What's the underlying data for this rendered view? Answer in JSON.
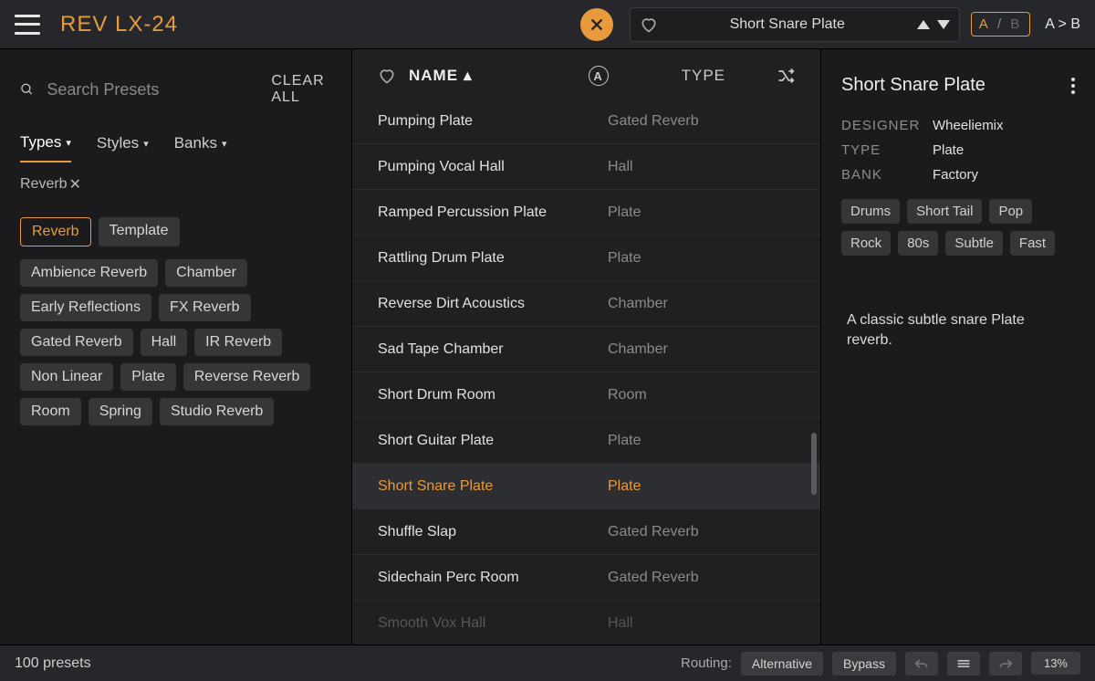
{
  "header": {
    "product_name": "REV LX-24",
    "current_preset": "Short Snare Plate",
    "ab": {
      "a": "A",
      "sep": "/",
      "b": "B",
      "copy": "A > B"
    }
  },
  "sidebar": {
    "search_placeholder": "Search Presets",
    "clear_all": "CLEAR ALL",
    "tabs": {
      "types": "Types",
      "styles": "Styles",
      "banks": "Banks"
    },
    "active_filter": "Reverb",
    "primary_tags": [
      "Reverb",
      "Template"
    ],
    "sub_tags": [
      "Ambience Reverb",
      "Chamber",
      "Early Reflections",
      "FX Reverb",
      "Gated Reverb",
      "Hall",
      "IR Reverb",
      "Non Linear",
      "Plate",
      "Reverse Reverb",
      "Room",
      "Spring",
      "Studio Reverb"
    ]
  },
  "list": {
    "cols": {
      "name": "NAME",
      "type": "TYPE"
    },
    "rows": [
      {
        "name": "Pumping Plate",
        "type": "Gated Reverb",
        "sel": false
      },
      {
        "name": "Pumping Vocal Hall",
        "type": "Hall",
        "sel": false
      },
      {
        "name": "Ramped Percussion Plate",
        "type": "Plate",
        "sel": false
      },
      {
        "name": "Rattling Drum Plate",
        "type": "Plate",
        "sel": false
      },
      {
        "name": "Reverse Dirt Acoustics",
        "type": "Chamber",
        "sel": false
      },
      {
        "name": "Sad Tape Chamber",
        "type": "Chamber",
        "sel": false
      },
      {
        "name": "Short Drum Room",
        "type": "Room",
        "sel": false
      },
      {
        "name": "Short Guitar Plate",
        "type": "Plate",
        "sel": false
      },
      {
        "name": "Short Snare Plate",
        "type": "Plate",
        "sel": true
      },
      {
        "name": "Shuffle Slap",
        "type": "Gated Reverb",
        "sel": false
      },
      {
        "name": "Sidechain Perc Room",
        "type": "Gated Reverb",
        "sel": false
      },
      {
        "name": "Smooth Vox Hall",
        "type": "Hall",
        "sel": false,
        "faded": true
      }
    ]
  },
  "detail": {
    "title": "Short Snare Plate",
    "meta": {
      "designer_k": "DESIGNER",
      "designer_v": "Wheeliemix",
      "type_k": "TYPE",
      "type_v": "Plate",
      "bank_k": "BANK",
      "bank_v": "Factory"
    },
    "tags": [
      "Drums",
      "Short Tail",
      "Pop",
      "Rock",
      "80s",
      "Subtle",
      "Fast"
    ],
    "description": "A classic subtle snare Plate reverb."
  },
  "footer": {
    "count": "100 presets",
    "routing_label": "Routing:",
    "routing_value": "Alternative",
    "bypass": "Bypass",
    "cpu": "13%"
  }
}
